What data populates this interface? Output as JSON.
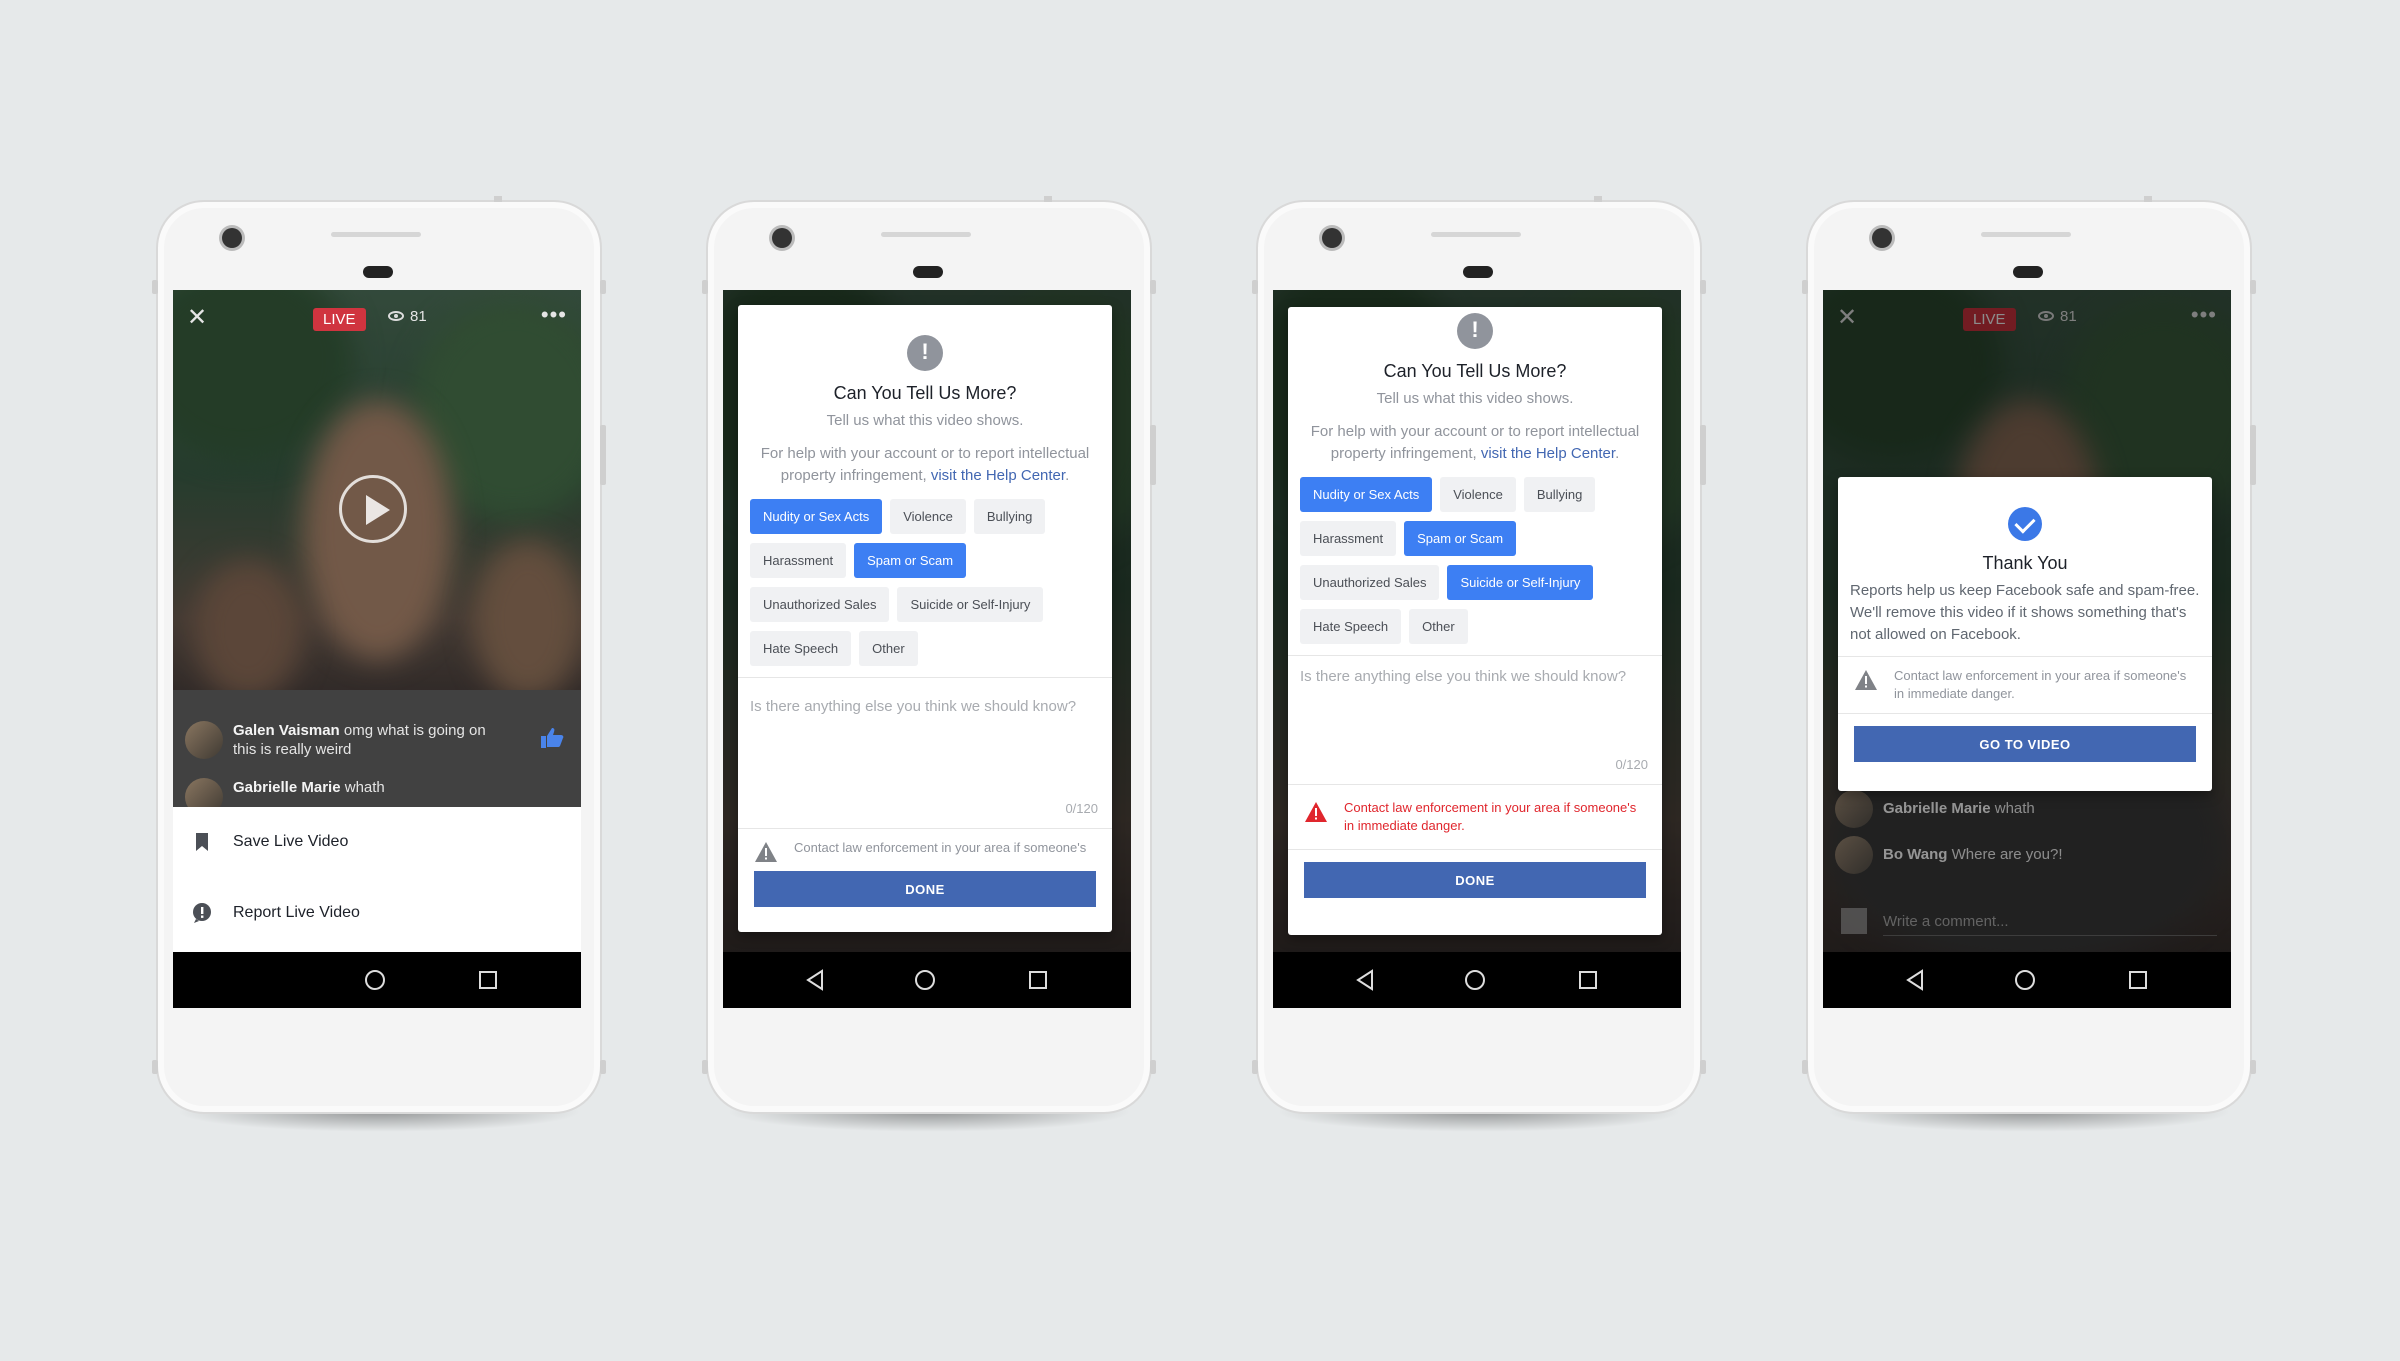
{
  "live": {
    "badge": "LIVE",
    "viewers": "81"
  },
  "comments": [
    {
      "name": "Galen Vaisman",
      "text": "omg what is going on this is really weird"
    },
    {
      "name": "Gabrielle Marie",
      "text": "whath"
    },
    {
      "name": "Bo Wang",
      "text": "Where are you?!"
    }
  ],
  "menu": {
    "save": "Save Live Video",
    "report": "Report Live Video"
  },
  "report_dialog": {
    "title": "Can You Tell Us More?",
    "subtitle": "Tell us what this video shows.",
    "help_text": "For help with your account or to report intellectual property infringement,",
    "help_link": "visit the Help Center",
    "help_end": ".",
    "textarea_placeholder": "Is there anything else you think we should know?",
    "counter": "0/120",
    "warning": "Contact law enforcement in your area if someone's in immediate danger.",
    "warning_truncated": "Contact law enforcement in your area if someone's",
    "done": "DONE"
  },
  "chips": [
    "Nudity or Sex Acts",
    "Violence",
    "Bullying",
    "Harassment",
    "Spam or Scam",
    "Unauthorized Sales",
    "Suicide or Self-Injury",
    "Hate Speech",
    "Other"
  ],
  "screen2_selected": [
    "Nudity or Sex Acts",
    "Spam or Scam"
  ],
  "screen3_selected": [
    "Nudity or Sex Acts",
    "Spam or Scam",
    "Suicide or Self-Injury"
  ],
  "thanks_dialog": {
    "title": "Thank You",
    "body": "Reports help us keep Facebook safe and spam-free. We'll remove this video if it shows something that's not allowed on Facebook.",
    "warning": "Contact law enforcement in your area if someone's in immediate danger.",
    "button": "GO TO VIDEO"
  },
  "write_comment": "Write a comment...",
  "colors": {
    "accent": "#4267b2",
    "chip_selected": "#3d7ff3",
    "live": "#d0343f",
    "warning_red": "#e0262d"
  }
}
